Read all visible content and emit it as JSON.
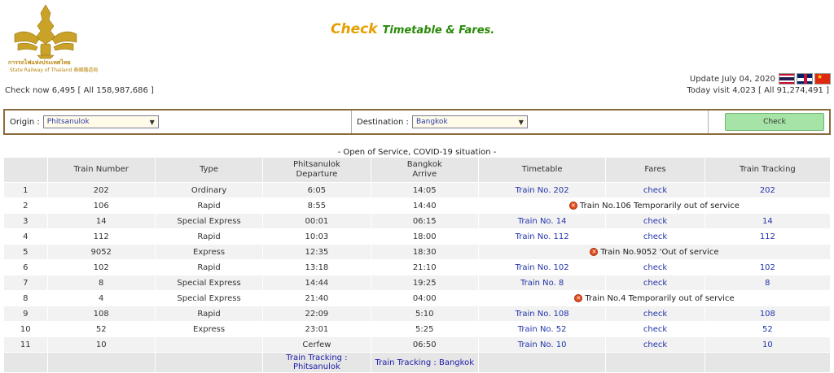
{
  "header": {
    "logo_text_th": "การรถไฟแห่งประเทศไทย",
    "logo_text_en": "State Railway of Thailand 泰國鐵道局",
    "title_check": "Check",
    "title_rest": "Timetable & Fares.",
    "check_now": "Check now  6,495  [ All   158,987,686  ]",
    "update": "Update July 04, 2020",
    "today_visit": "Today visit  4,023  [ All   91,274,491 ]",
    "flags": [
      "thai-flag-icon",
      "uk-flag-icon",
      "china-flag-icon"
    ]
  },
  "search": {
    "origin_label": "Origin :",
    "origin_value": "Phitsanulok",
    "destination_label": "Destination :",
    "destination_value": "Bangkok",
    "check_button": "Check"
  },
  "notice": "- Open of Service, COVID-19 situation -",
  "table": {
    "headers": {
      "num": "",
      "train_number": "Train Number",
      "type": "Type",
      "departure_station": "Phitsanulok",
      "departure_label": "Departure",
      "arrive_station": "Bangkok",
      "arrive_label": "Arrive",
      "timetable": "Timetable",
      "fares": "Fares",
      "tracking": "Train Tracking"
    },
    "rows": [
      {
        "n": "1",
        "train": "202",
        "type": "Ordinary",
        "dep": "6:05",
        "arr": "14:05",
        "timetable": "Train No. 202",
        "fares": "check",
        "tracking": "202",
        "notice": ""
      },
      {
        "n": "2",
        "train": "106",
        "type": "Rapid",
        "dep": "8:55",
        "arr": "14:40",
        "timetable": "",
        "fares": "",
        "tracking": "",
        "notice": "Train No.106 Temporarily out of service"
      },
      {
        "n": "3",
        "train": "14",
        "type": "Special Express",
        "dep": "00:01",
        "arr": "06:15",
        "timetable": "Train No. 14",
        "fares": "check",
        "tracking": "14",
        "notice": ""
      },
      {
        "n": "4",
        "train": "112",
        "type": "Rapid",
        "dep": "10:03",
        "arr": "18:00",
        "timetable": "Train No. 112",
        "fares": "check",
        "tracking": "112",
        "notice": ""
      },
      {
        "n": "5",
        "train": "9052",
        "type": "Express",
        "dep": "12:35",
        "arr": "18:30",
        "timetable": "",
        "fares": "",
        "tracking": "",
        "notice": "Train No.9052 'Out of service"
      },
      {
        "n": "6",
        "train": "102",
        "type": "Rapid",
        "dep": "13:18",
        "arr": "21:10",
        "timetable": "Train No. 102",
        "fares": "check",
        "tracking": "102",
        "notice": ""
      },
      {
        "n": "7",
        "train": "8",
        "type": "Special Express",
        "dep": "14:44",
        "arr": "19:25",
        "timetable": "Train No. 8",
        "fares": "check",
        "tracking": "8",
        "notice": ""
      },
      {
        "n": "8",
        "train": "4",
        "type": "Special Express",
        "dep": "21:40",
        "arr": "04:00",
        "timetable": "",
        "fares": "",
        "tracking": "",
        "notice": "Train No.4 Temporarily out of service"
      },
      {
        "n": "9",
        "train": "108",
        "type": "Rapid",
        "dep": "22:09",
        "arr": "5:10",
        "timetable": "Train No. 108",
        "fares": "check",
        "tracking": "108",
        "notice": ""
      },
      {
        "n": "10",
        "train": "52",
        "type": "Express",
        "dep": "23:01",
        "arr": "5:25",
        "timetable": "Train No. 52",
        "fares": "check",
        "tracking": "52",
        "notice": ""
      },
      {
        "n": "11",
        "train": "10",
        "type": "",
        "dep": "Cerfew",
        "arr": "06:50",
        "timetable": "Train No. 10",
        "fares": "check",
        "tracking": "10",
        "notice": ""
      }
    ],
    "footer": {
      "tracking_origin": "Train Tracking : Phitsanulok",
      "tracking_destination": "Train Tracking : Bangkok"
    }
  }
}
